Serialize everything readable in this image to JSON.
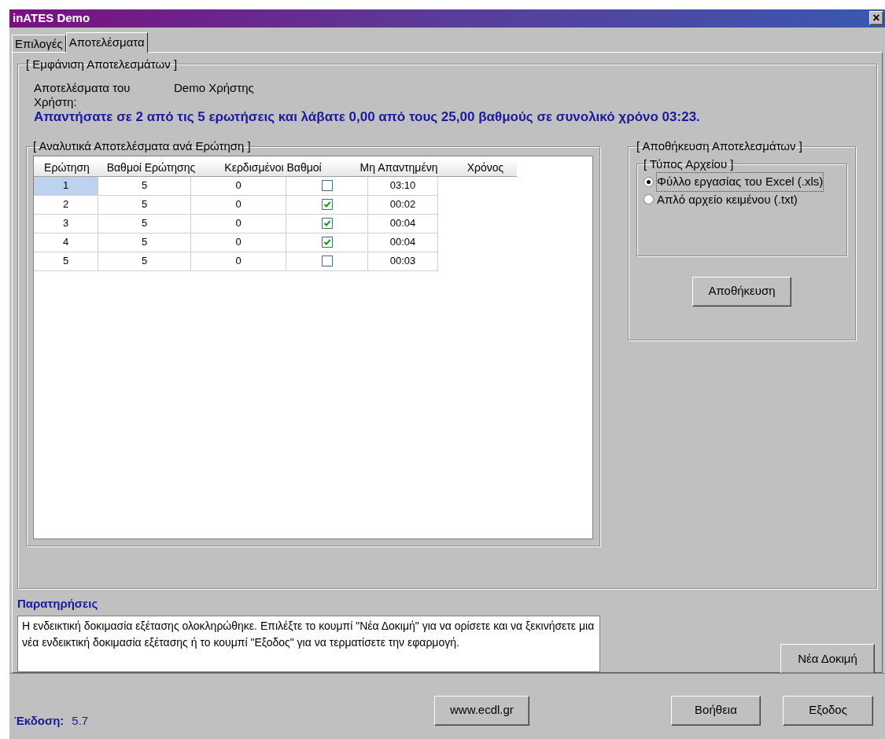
{
  "window": {
    "title": "inATES Demo",
    "close": "×"
  },
  "tabs": [
    {
      "label": "Επιλογές",
      "selected": false
    },
    {
      "label": "Αποτελέσματα",
      "selected": true
    }
  ],
  "results_group": {
    "legend": "[ Εμφάνιση Αποτελεσμάτων ]",
    "user_label": "Αποτελέσματα του Χρήστη:",
    "user_name": "Demo Χρήστης",
    "summary": "Απαντήσατε σε 2 από τις 5 ερωτήσεις και λάβατε 0,00 από τους 25,00 βαθμούς σε συνολικό χρόνο 03:23."
  },
  "details_group": {
    "legend": "[ Αναλυτικά Αποτελέσματα ανά Ερώτηση ]",
    "table": {
      "columns": [
        "Ερώτηση",
        "Βαθμοί Ερώτησης",
        "Κερδισμένοι Βαθμοί",
        "Μη Απαντημένη",
        "Χρόνος"
      ],
      "rows": [
        {
          "question": "1",
          "points": "5",
          "earned": "0",
          "unanswered": false,
          "time": "03:10",
          "selected": true
        },
        {
          "question": "2",
          "points": "5",
          "earned": "0",
          "unanswered": true,
          "time": "00:02",
          "selected": false
        },
        {
          "question": "3",
          "points": "5",
          "earned": "0",
          "unanswered": true,
          "time": "00:04",
          "selected": false
        },
        {
          "question": "4",
          "points": "5",
          "earned": "0",
          "unanswered": true,
          "time": "00:04",
          "selected": false
        },
        {
          "question": "5",
          "points": "5",
          "earned": "0",
          "unanswered": false,
          "time": "00:03",
          "selected": false
        }
      ]
    }
  },
  "save_group": {
    "legend": "[ Αποθήκευση Αποτελεσμάτων ]",
    "file_type_legend": "[ Τύπος Αρχείου ]",
    "options": [
      {
        "label": "Φύλλο εργασίας του Excel (.xls)",
        "selected": true
      },
      {
        "label": "Απλό αρχείο κειμένου (.txt)",
        "selected": false
      }
    ],
    "button": "Αποθήκευση"
  },
  "remarks": {
    "label": "Παρατηρήσεις",
    "text": "Η ενδεικτική δοκιμασία εξέτασης ολοκληρώθηκε. Επιλέξτε το κουμπί \"Νέα Δοκιμή\" για να ορίσετε και να ξεκινήσετε μια νέα ενδεικτική δοκιμασία εξέτασης ή το κουμπί \"Εξοδος\" για να τερματίσετε την εφαρμογή."
  },
  "new_test_button": "Νέα Δοκιμή",
  "footer": {
    "version_label": "Έκδοση:",
    "version": "5.7",
    "website_button": "www.ecdl.gr",
    "help_button": "Βοήθεια",
    "exit_button": "Εξοδος"
  }
}
